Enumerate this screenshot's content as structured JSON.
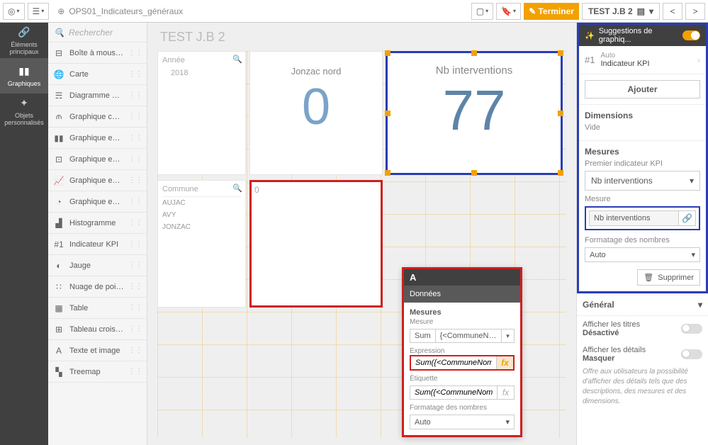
{
  "topbar": {
    "doc_title": "OPS01_Indicateurs_généraux",
    "terminer": "Terminer",
    "sheet_name": "TEST J.B 2"
  },
  "rail": {
    "elements": "Éléments principaux",
    "graphiques": "Graphiques",
    "objets": "Objets personnalisés"
  },
  "search": {
    "placeholder": "Rechercher"
  },
  "assets": [
    {
      "icon": "⊟",
      "label": "Boîte à mousta..."
    },
    {
      "icon": "🌐",
      "label": "Carte"
    },
    {
      "icon": "☴",
      "label": "Diagramme de..."
    },
    {
      "icon": "⫙",
      "label": "Graphique com..."
    },
    {
      "icon": "▮▮",
      "label": "Graphique en b..."
    },
    {
      "icon": "⊡",
      "label": "Graphique en c..."
    },
    {
      "icon": "📈",
      "label": "Graphique en c..."
    },
    {
      "icon": "◔",
      "label": "Graphique en s..."
    },
    {
      "icon": "▟",
      "label": "Histogramme"
    },
    {
      "icon": "#1",
      "label": "Indicateur KPI"
    },
    {
      "icon": "◐",
      "label": "Jauge"
    },
    {
      "icon": "∷",
      "label": "Nuage de points"
    },
    {
      "icon": "▦",
      "label": "Table"
    },
    {
      "icon": "⊞",
      "label": "Tableau croisé..."
    },
    {
      "icon": "A",
      "label": "Texte et image"
    },
    {
      "icon": "▚",
      "label": "Treemap"
    }
  ],
  "canvas": {
    "title": "TEST J.B 2",
    "year_label": "Année",
    "year_value": "2018",
    "jonzac_title": "Jonzac nord",
    "jonzac_value": "0",
    "kpi_title": "Nb interventions",
    "kpi_value": "77",
    "commune_header": "Commune",
    "commune_rows": [
      "AUJAC",
      "AVY",
      "JONZAC"
    ],
    "red_zero": "0"
  },
  "popover": {
    "head": "A",
    "tab": "Données",
    "mesures": "Mesures",
    "mesure_sub": "Mesure",
    "sum": "Sum",
    "sum_arg": "{<CommuneNom={...",
    "expression_lbl": "Expression",
    "expression_val": "Sum({<CommuneNom={'J",
    "etiquette_lbl": "Étiquette",
    "etiquette_val": "Sum({<CommuneNom={'J",
    "format_lbl": "Formatage des nombres",
    "format_val": "Auto"
  },
  "props": {
    "sugg": "Suggestions de graphiq...",
    "kpi_num": "#1",
    "kpi_auto": "Auto",
    "kpi_label": "Indicateur KPI",
    "ajouter": "Ajouter",
    "dimensions": "Dimensions",
    "vide": "Vide",
    "mesures": "Mesures",
    "mesures_sub": "Premier indicateur KPI",
    "acc_label": "Nb interventions",
    "mesure_lbl": "Mesure",
    "mesure_val": "Nb interventions",
    "format_lbl": "Formatage des nombres",
    "format_val": "Auto",
    "supprimer": "Supprimer",
    "general": "Général",
    "titres_lbl": "Afficher les titres",
    "titres_val": "Désactivé",
    "details_lbl": "Afficher les détails",
    "details_val": "Masquer",
    "hint": "Offre aux utilisateurs la possibilité d'afficher des détails tels que des descriptions, des mesures et des dimensions."
  }
}
